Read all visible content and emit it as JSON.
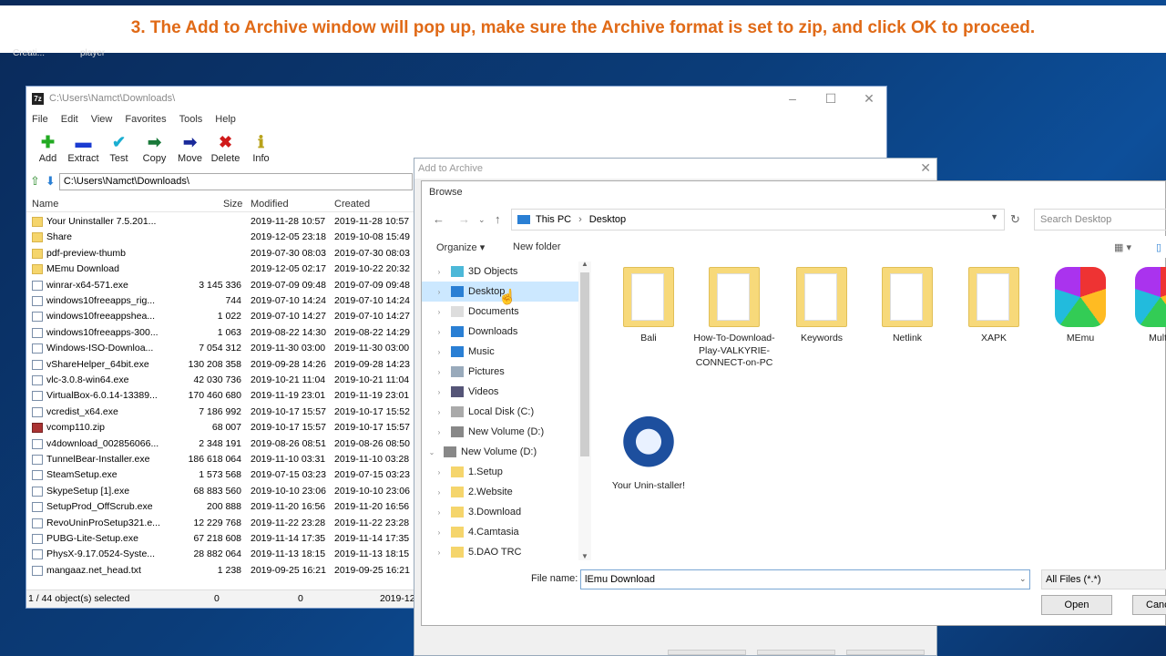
{
  "banner": {
    "text": "3. The Add to Archive window will pop up, make sure the Archive format is set to zip, and click OK to proceed."
  },
  "desktop": {
    "label1": "Creati...",
    "label2": "player"
  },
  "file_manager": {
    "title": "C:\\Users\\Namct\\Downloads\\",
    "menu": [
      "File",
      "Edit",
      "View",
      "Favorites",
      "Tools",
      "Help"
    ],
    "toolbar": [
      {
        "label": "Add",
        "icon": "plus-icon",
        "color": "#22aa22",
        "glyph": "✚"
      },
      {
        "label": "Extract",
        "icon": "minus-icon",
        "color": "#1a3bd1",
        "glyph": "▬"
      },
      {
        "label": "Test",
        "icon": "check-icon",
        "color": "#1aaed1",
        "glyph": "✔"
      },
      {
        "label": "Copy",
        "icon": "copy-arrow-icon",
        "color": "#1a7a3a",
        "glyph": "➡"
      },
      {
        "label": "Move",
        "icon": "move-arrow-icon",
        "color": "#1a2a9a",
        "glyph": "➡"
      },
      {
        "label": "Delete",
        "icon": "delete-x-icon",
        "color": "#d01a1a",
        "glyph": "✖"
      },
      {
        "label": "Info",
        "icon": "info-icon",
        "color": "#b8a21a",
        "glyph": "ℹ"
      }
    ],
    "path": "C:\\Users\\Namct\\Downloads\\",
    "columns": [
      "Name",
      "Size",
      "Modified",
      "Created"
    ],
    "rows": [
      {
        "type": "folder",
        "name": "Your Uninstaller 7.5.201...",
        "size": "",
        "modified": "2019-11-28 10:57",
        "created": "2019-11-28 10:57"
      },
      {
        "type": "folder",
        "name": "Share",
        "size": "",
        "modified": "2019-12-05 23:18",
        "created": "2019-10-08 15:49"
      },
      {
        "type": "folder",
        "name": "pdf-preview-thumb",
        "size": "",
        "modified": "2019-07-30 08:03",
        "created": "2019-07-30 08:03"
      },
      {
        "type": "folder",
        "name": "MEmu Download",
        "size": "",
        "modified": "2019-12-05 02:17",
        "created": "2019-10-22 20:32"
      },
      {
        "type": "file",
        "name": "winrar-x64-571.exe",
        "size": "3 145 336",
        "modified": "2019-07-09 09:48",
        "created": "2019-07-09 09:48"
      },
      {
        "type": "file",
        "name": "windows10freeapps_rig...",
        "size": "744",
        "modified": "2019-07-10 14:24",
        "created": "2019-07-10 14:24"
      },
      {
        "type": "file",
        "name": "windows10freeappshea...",
        "size": "1 022",
        "modified": "2019-07-10 14:27",
        "created": "2019-07-10 14:27"
      },
      {
        "type": "file",
        "name": "windows10freeapps-300...",
        "size": "1 063",
        "modified": "2019-08-22 14:30",
        "created": "2019-08-22 14:29"
      },
      {
        "type": "file",
        "name": "Windows-ISO-Downloa...",
        "size": "7 054 312",
        "modified": "2019-11-30 03:00",
        "created": "2019-11-30 03:00"
      },
      {
        "type": "file",
        "name": "vShareHelper_64bit.exe",
        "size": "130 208 358",
        "modified": "2019-09-28 14:26",
        "created": "2019-09-28 14:23"
      },
      {
        "type": "file",
        "name": "vlc-3.0.8-win64.exe",
        "size": "42 030 736",
        "modified": "2019-10-21 11:04",
        "created": "2019-10-21 11:04"
      },
      {
        "type": "file",
        "name": "VirtualBox-6.0.14-13389...",
        "size": "170 460 680",
        "modified": "2019-11-19 23:01",
        "created": "2019-11-19 23:01"
      },
      {
        "type": "file",
        "name": "vcredist_x64.exe",
        "size": "7 186 992",
        "modified": "2019-10-17 15:57",
        "created": "2019-10-17 15:52"
      },
      {
        "type": "zip",
        "name": "vcomp110.zip",
        "size": "68 007",
        "modified": "2019-10-17 15:57",
        "created": "2019-10-17 15:57"
      },
      {
        "type": "file",
        "name": "v4download_002856066...",
        "size": "2 348 191",
        "modified": "2019-08-26 08:51",
        "created": "2019-08-26 08:50"
      },
      {
        "type": "file",
        "name": "TunnelBear-Installer.exe",
        "size": "186 618 064",
        "modified": "2019-11-10 03:31",
        "created": "2019-11-10 03:28"
      },
      {
        "type": "file",
        "name": "SteamSetup.exe",
        "size": "1 573 568",
        "modified": "2019-07-15 03:23",
        "created": "2019-07-15 03:23"
      },
      {
        "type": "file",
        "name": "SkypeSetup [1].exe",
        "size": "68 883 560",
        "modified": "2019-10-10 23:06",
        "created": "2019-10-10 23:06"
      },
      {
        "type": "file",
        "name": "SetupProd_OffScrub.exe",
        "size": "200 888",
        "modified": "2019-11-20 16:56",
        "created": "2019-11-20 16:56"
      },
      {
        "type": "file",
        "name": "RevoUninProSetup321.e...",
        "size": "12 229 768",
        "modified": "2019-11-22 23:28",
        "created": "2019-11-22 23:28"
      },
      {
        "type": "file",
        "name": "PUBG-Lite-Setup.exe",
        "size": "67 218 608",
        "modified": "2019-11-14 17:35",
        "created": "2019-11-14 17:35"
      },
      {
        "type": "file",
        "name": "PhysX-9.17.0524-Syste...",
        "size": "28 882 064",
        "modified": "2019-11-13 18:15",
        "created": "2019-11-13 18:15"
      },
      {
        "type": "file",
        "name": "mangaaz.net_head.txt",
        "size": "1 238",
        "modified": "2019-09-25 16:21",
        "created": "2019-09-25 16:21"
      }
    ],
    "status": {
      "selected": "1 / 44 object(s) selected",
      "s1": "0",
      "s2": "0",
      "s3": "2019-12"
    }
  },
  "add_to_archive": {
    "title": "Add to Archive",
    "close": "✕"
  },
  "browse": {
    "title": "Browse",
    "crumbs": [
      "This PC",
      "Desktop"
    ],
    "search_placeholder": "Search Desktop",
    "organize": "Organize ▾",
    "new_folder": "New folder",
    "tree": [
      {
        "label": "3D Objects",
        "icon": "cube-icon",
        "color": "#4cb8d8",
        "indent": 1,
        "selected": false
      },
      {
        "label": "Desktop",
        "icon": "desktop-icon",
        "color": "#2a7fd4",
        "indent": 1,
        "selected": true
      },
      {
        "label": "Documents",
        "icon": "documents-icon",
        "color": "#ddd",
        "indent": 1,
        "selected": false
      },
      {
        "label": "Downloads",
        "icon": "download-icon",
        "color": "#2a7fd4",
        "indent": 1,
        "selected": false
      },
      {
        "label": "Music",
        "icon": "music-icon",
        "color": "#2a7fd4",
        "indent": 1,
        "selected": false
      },
      {
        "label": "Pictures",
        "icon": "pictures-icon",
        "color": "#9ab",
        "indent": 1,
        "selected": false
      },
      {
        "label": "Videos",
        "icon": "videos-icon",
        "color": "#557",
        "indent": 1,
        "selected": false
      },
      {
        "label": "Local Disk (C:)",
        "icon": "disk-icon",
        "color": "#aaa",
        "indent": 1,
        "selected": false
      },
      {
        "label": "New Volume (D:)",
        "icon": "disk-icon",
        "color": "#888",
        "indent": 1,
        "selected": false
      },
      {
        "label": "New Volume (D:)",
        "icon": "disk-icon",
        "color": "#888",
        "indent": 0,
        "selected": false
      },
      {
        "label": "1.Setup",
        "icon": "folder-icon",
        "color": "#f5d56c",
        "indent": 1,
        "selected": false
      },
      {
        "label": "2.Website",
        "icon": "folder-icon",
        "color": "#f5d56c",
        "indent": 1,
        "selected": false
      },
      {
        "label": "3.Download",
        "icon": "folder-icon",
        "color": "#f5d56c",
        "indent": 1,
        "selected": false
      },
      {
        "label": "4.Camtasia",
        "icon": "folder-icon",
        "color": "#f5d56c",
        "indent": 1,
        "selected": false
      },
      {
        "label": "5.DAO TRC",
        "icon": "folder-icon",
        "color": "#f5d56c",
        "indent": 1,
        "selected": false
      }
    ],
    "files": [
      {
        "label": "Bali",
        "kind": "folder"
      },
      {
        "label": "How-To-Download-Play-VALKYRIE-CONNECT-on-PC",
        "kind": "folder"
      },
      {
        "label": "Keywords",
        "kind": "folder"
      },
      {
        "label": "Netlink",
        "kind": "folder"
      },
      {
        "label": "XAPK",
        "kind": "folder"
      },
      {
        "label": "MEmu",
        "kind": "app"
      },
      {
        "label": "Multi-",
        "kind": "app"
      },
      {
        "label": "Your Unin-staller!",
        "kind": "app"
      }
    ],
    "file_name_label": "File name:",
    "file_name_value": "lEmu Download",
    "filter": "All Files (*.*)",
    "open": "Open",
    "cancel": "Canc"
  }
}
